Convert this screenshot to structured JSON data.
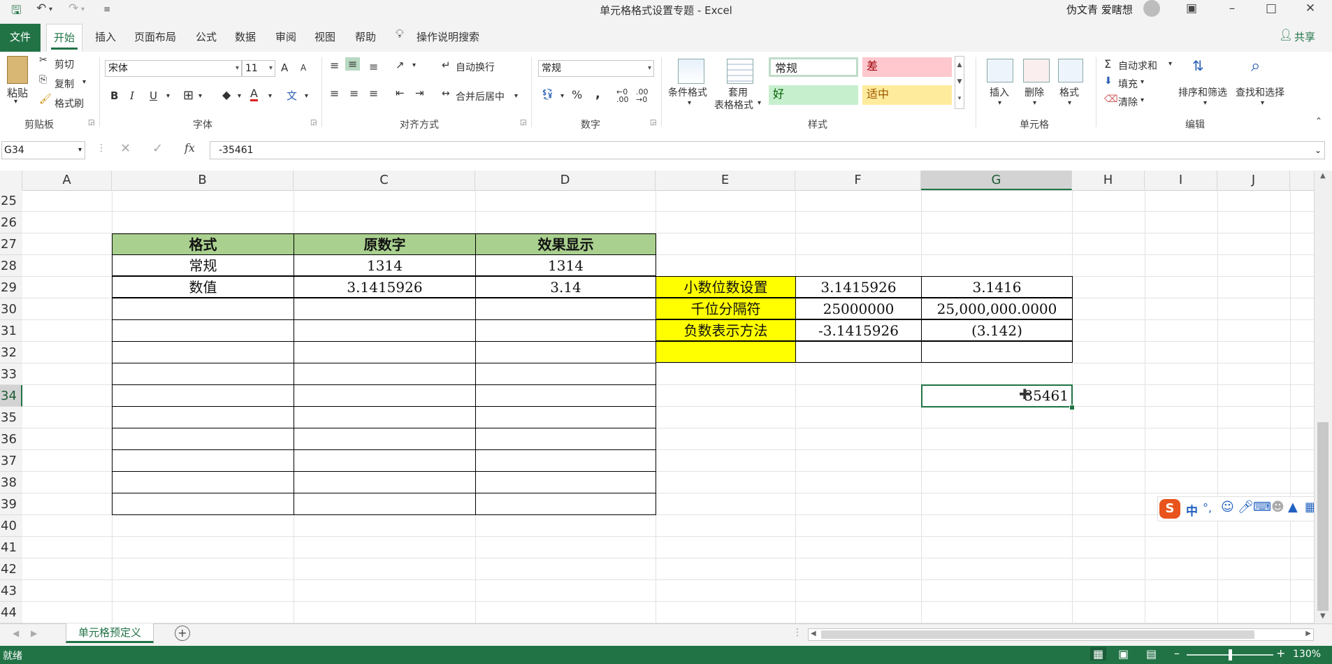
{
  "window": {
    "title": "单元格格式设置专题  -  Excel",
    "user": "伪文青 爱瞎想"
  },
  "tabs": [
    "文件",
    "开始",
    "插入",
    "页面布局",
    "公式",
    "数据",
    "审阅",
    "视图",
    "帮助"
  ],
  "tell_me": "操作说明搜索",
  "share": "共享",
  "ribbon": {
    "clipboard": {
      "paste": "粘贴",
      "cut": "剪切",
      "copy": "复制",
      "format_painter": "格式刷",
      "label": "剪贴板"
    },
    "font": {
      "name": "宋体",
      "size": "11",
      "bold": "B",
      "italic": "I",
      "underline": "U",
      "label": "字体",
      "grow": "A",
      "shrink": "A"
    },
    "alignment": {
      "wrap": "自动换行",
      "merge": "合并后居中",
      "label": "对齐方式"
    },
    "number": {
      "format": "常规",
      "percent": "%",
      "comma": ",",
      "label": "数字"
    },
    "styles": {
      "conditional": "条件格式",
      "table_line1": "套用",
      "table_line2": "表格格式",
      "normal": "常规",
      "bad": "差",
      "good": "好",
      "neutral": "适中",
      "label": "样式"
    },
    "cells": {
      "insert": "插入",
      "delete": "删除",
      "format": "格式",
      "label": "单元格"
    },
    "editing": {
      "autosum": "自动求和",
      "fill": "填充",
      "clear": "清除",
      "sort": "排序和筛选",
      "find": "查找和选择",
      "label": "编辑"
    }
  },
  "formula_bar": {
    "name_box": "G34",
    "fx": "fx",
    "value": "-35461"
  },
  "columns": [
    "A",
    "B",
    "C",
    "D",
    "E",
    "F",
    "G",
    "H",
    "I",
    "J"
  ],
  "rows": [
    "25",
    "26",
    "27",
    "28",
    "29",
    "30",
    "31",
    "32",
    "33",
    "34",
    "35",
    "36",
    "37",
    "38",
    "39",
    "40",
    "41",
    "42",
    "43",
    "44"
  ],
  "table1": {
    "headers": [
      "格式",
      "原数字",
      "效果显示"
    ],
    "rows": [
      [
        "常规",
        "1314",
        "1314"
      ],
      [
        "数值",
        "3.1415926",
        "3.14"
      ]
    ]
  },
  "table2": [
    [
      "小数位数设置",
      "3.1415926",
      "3.1416"
    ],
    [
      "千位分隔符",
      "25000000",
      "25,000,000.0000"
    ],
    [
      "负数表示方法",
      "-3.1415926",
      "(3.142)"
    ]
  ],
  "active_cell_value": "35461",
  "sheet_tab": "单元格预定义",
  "status": {
    "ready": "就绪",
    "zoom": "130%"
  },
  "ime": {
    "label": "中"
  },
  "colors": {
    "excel_green": "#217346",
    "header_green": "#a9d08e",
    "highlight_yellow": "#ffff00",
    "bad_fill": "#ffc7ce",
    "good_fill": "#c6efce",
    "neutral_fill": "#ffeb9c"
  }
}
